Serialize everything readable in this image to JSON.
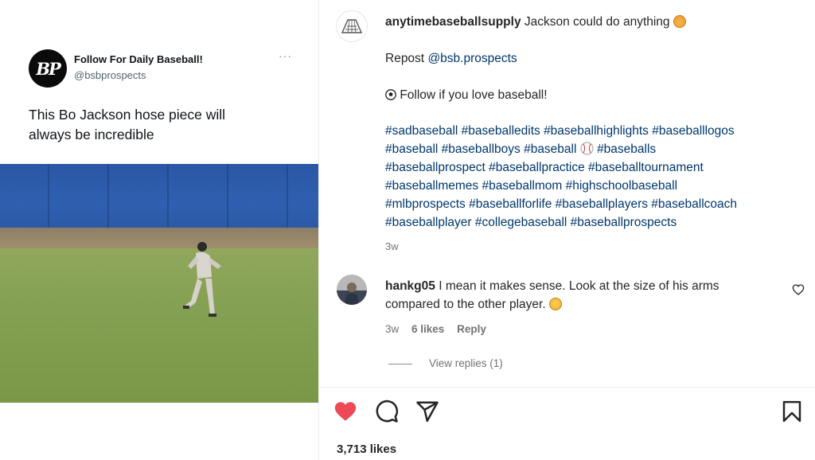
{
  "media": {
    "tweet": {
      "avatar_text": "BP",
      "name": "Follow For Daily Baseball!",
      "handle": "@bsbprospects",
      "more": "···",
      "text_line1": "This Bo Jackson hose piece will",
      "text_line2": "always be incredible"
    },
    "video_description": "baseball-outfield-throw-clip"
  },
  "post": {
    "username": "anytimebaseballsupply",
    "caption_lead": "Jackson could do anything",
    "repost_prefix": "Repost",
    "repost_handle": "@bsb.prospects",
    "follow_line": "Follow if you love baseball!",
    "hashtag_lines": [
      "#sadbaseball #baseballedits #baseballhighlights #baseballlogos",
      "#baseball #baseballboys #baseball",
      "#baseballprospect #baseballpractice #baseballtournament",
      "#baseballmemes #baseballmom #highschoolbaseball",
      "#mlbprospects #baseballforlife #baseballplayers #baseballcoach",
      "#baseballplayer #collegebaseball #baseballprospects"
    ],
    "hashtag_line2_tail": "#baseballs",
    "age": "3w"
  },
  "comment": {
    "username": "hankg05",
    "text_line1": "I mean it makes sense. Look at the size of his arms",
    "text_line2": "compared to the other player.",
    "age": "3w",
    "likes": "6 likes",
    "reply": "Reply",
    "view_replies": "View replies (1)"
  },
  "actions": {
    "likes_count": "3,713 likes",
    "heart_color": "#ed4956"
  },
  "icons": [
    "heart-icon",
    "comment-icon",
    "share-icon",
    "bookmark-icon",
    "small-heart-icon",
    "baseball-icon",
    "emoji-icon"
  ],
  "colors": {
    "hashtag": "#00376b",
    "muted": "#737373",
    "text": "#262626"
  }
}
